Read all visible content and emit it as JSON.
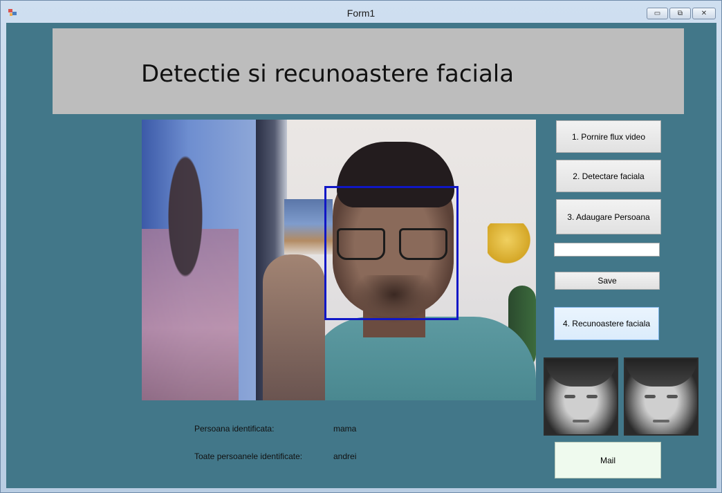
{
  "window": {
    "title": "Form1",
    "icons": [
      "app-icon",
      "minimize-icon",
      "maximize-icon",
      "close-icon"
    ]
  },
  "header": {
    "title": "Detectie si recunoastere faciala"
  },
  "buttons": {
    "start_video": "1. Pornire flux video",
    "detect_face": "2. Detectare faciala",
    "add_person": "3. Adaugare Persoana",
    "save": "Save",
    "recognize": "4. Recunoastere faciala",
    "mail": "Mail"
  },
  "name_input": {
    "value": ""
  },
  "results": {
    "identified_label": "Persoana identificata:",
    "identified_value": "mama",
    "all_label": "Toate persoanele identificate:",
    "all_value": "andrei"
  },
  "colors": {
    "client_background": "#427789",
    "header_panel": "#bdbdbd",
    "face_box": "#1017c6",
    "recognize_button": "#dbecfc",
    "mail_button": "#effaee"
  }
}
